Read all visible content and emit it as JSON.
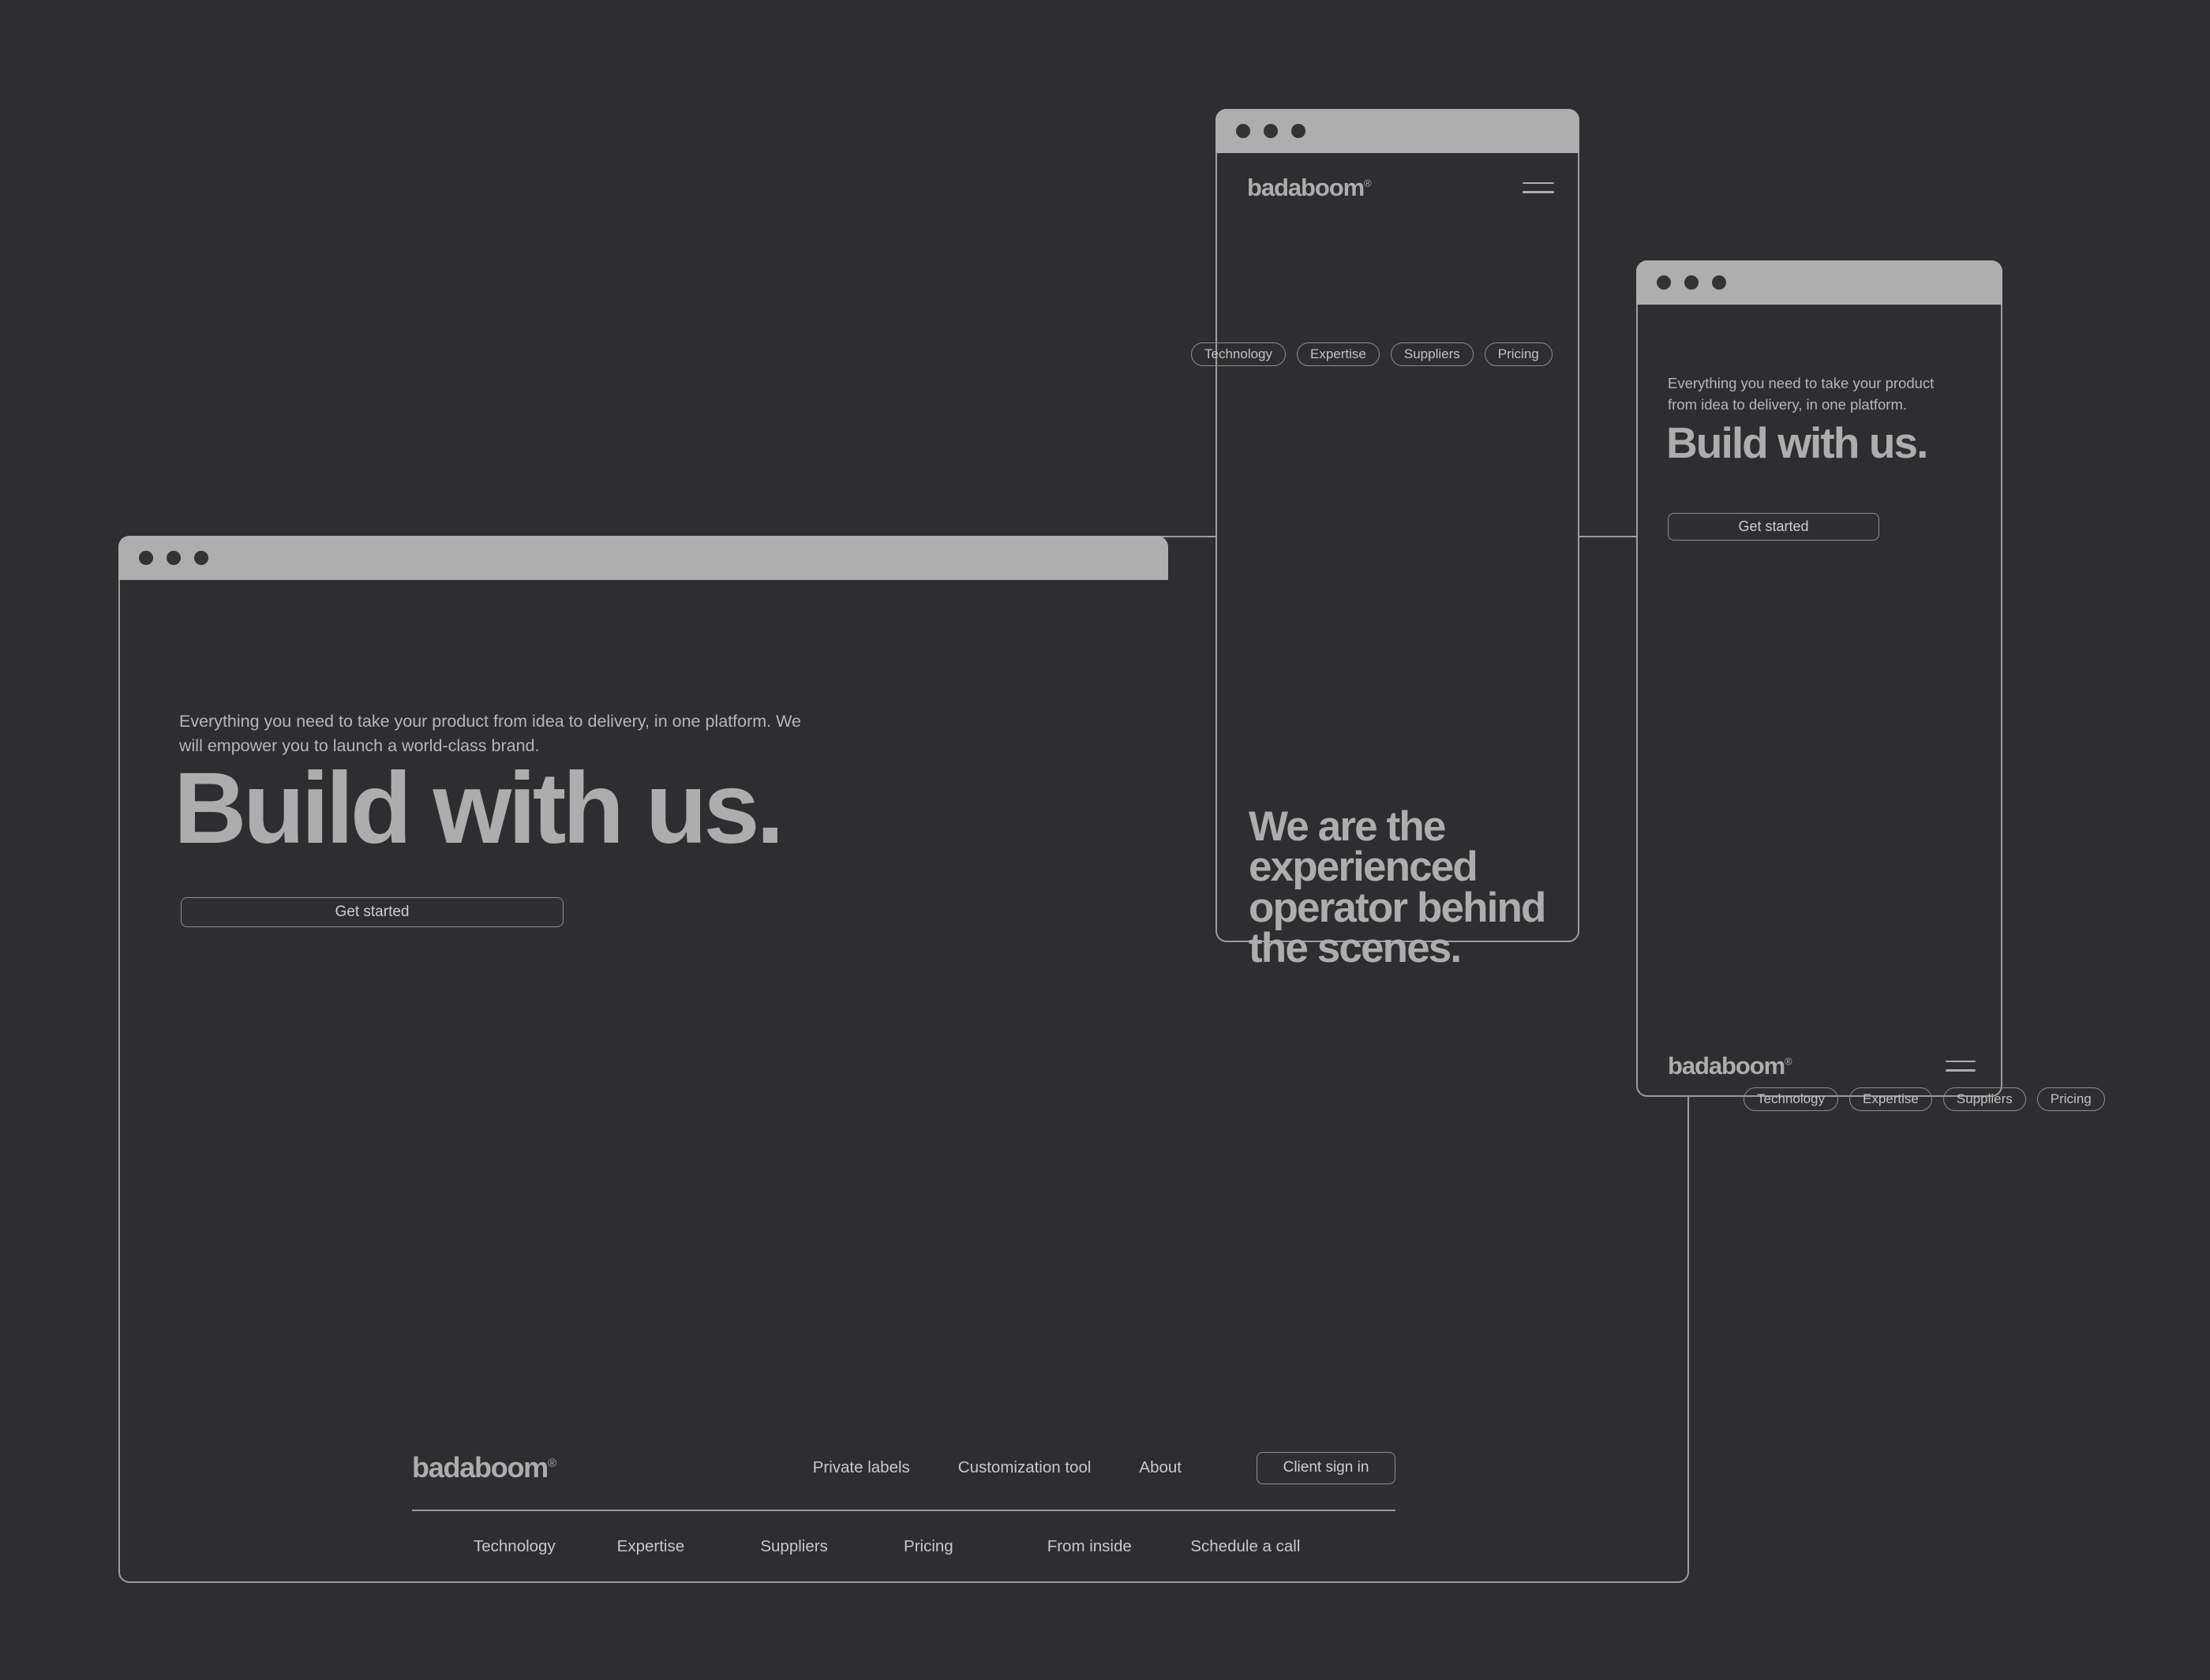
{
  "brand": {
    "name": "badaboom",
    "registered_mark": "®"
  },
  "theme": {
    "page_background": "#2e2d30",
    "titlebar_background": "#aeaeae",
    "window_border": "#9c9c9c",
    "heading_text": "#adadad",
    "body_text": "#b6b6b6",
    "outline_border": "#8d8d8d"
  },
  "icons": {
    "traffic_light": "window-dot",
    "menu": "hamburger-menu-icon"
  },
  "desktop_window": {
    "lede": "Everything you need to take your product from idea to delivery, in one platform. We will empower you to launch a world-class brand.",
    "headline": "Build with us.",
    "cta_label": "Get started",
    "footer": {
      "logo": "badaboom",
      "primary_links": [
        "Private labels",
        "Customization tool",
        "About"
      ],
      "signin_label": "Client sign in",
      "secondary_links": [
        "Technology",
        "Expertise",
        "Suppliers",
        "Pricing",
        "From inside",
        "Schedule a call"
      ]
    }
  },
  "tablet_window": {
    "logo": "badaboom",
    "nav_pills": [
      "Technology",
      "Expertise",
      "Suppliers",
      "Pricing"
    ],
    "headline": "We are the experienced operator behind the scenes."
  },
  "mobile_window": {
    "lede": "Everything you need to take your product from idea to delivery, in one platform.",
    "headline": "Build with us.",
    "cta_label": "Get started",
    "logo": "badaboom",
    "nav_pills": [
      "Technology",
      "Expertise",
      "Suppliers",
      "Pricing"
    ]
  }
}
